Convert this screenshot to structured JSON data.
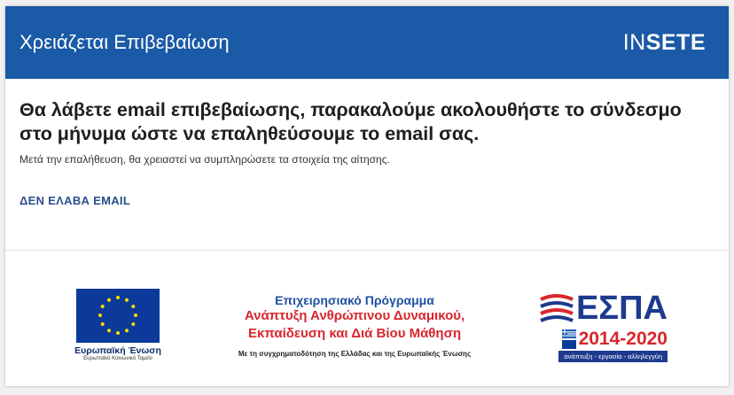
{
  "header": {
    "title": "Χρειάζεται Επιβεβαίωση",
    "logo_prefix": "IN",
    "logo_suffix": "SETE"
  },
  "main": {
    "headline": "Θα λάβετε email επιβεβαίωσης, παρακαλούμε ακολουθήστε το σύνδεσμο στο μήνυμα ώστε να επαληθεύσουμε το email σας.",
    "subtext": "Μετά την επαλήθευση, θα χρειαστεί να συμπληρώσετε τα στοιχεία της αίτησης.",
    "resend_link": "ΔΕΝ ΕΛΑΒΑ EMAIL"
  },
  "banner": {
    "eu_name": "Ευρωπαϊκή Ένωση",
    "eu_fund": "Ευρωπαϊκό Κοινωνικό Ταμείο",
    "program_title": "Επιχειρησιακό Πρόγραμμα",
    "program_line1": "Ανάπτυξη Ανθρώπινου Δυναμικού,",
    "program_line2": "Εκπαίδευση και Διά Βίου Μάθηση",
    "cofunding_note": "Με τη συγχρηματοδότηση της Ελλάδας και της Ευρωπαϊκής Ένωσης",
    "espa_word": "ΕΣΠΑ",
    "espa_years": "2014-2020",
    "espa_slogan": "ανάπτυξη - εργασία - αλληλεγγύη"
  },
  "colors": {
    "header_bg": "#1a5aa6",
    "link": "#2a4f8c",
    "red": "#d9262c",
    "eu_blue": "#0b3a9a"
  }
}
